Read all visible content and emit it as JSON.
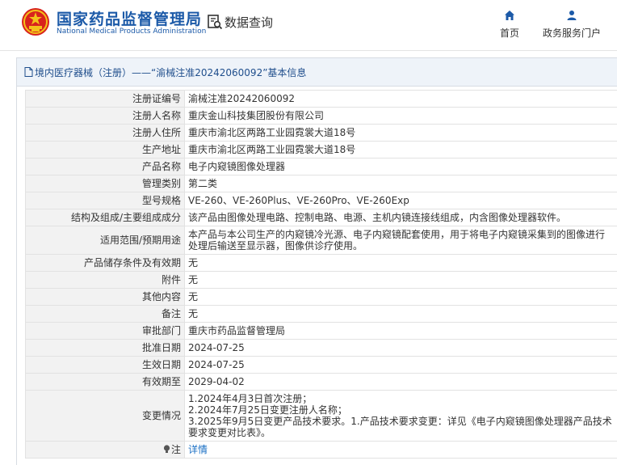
{
  "header": {
    "title_cn": "国家药品监督管理局",
    "title_en": "National Medical Products Administration",
    "query_label": "数据查询",
    "nav": [
      {
        "label": "首页",
        "icon": "home-icon"
      },
      {
        "label": "政务服务门户",
        "icon": "user-icon"
      }
    ]
  },
  "breadcrumb": {
    "text": "境内医疗器械（注册）——“渝械注准20242060092”基本信息"
  },
  "details": {
    "label": "注",
    "link": "详情"
  },
  "rows": [
    {
      "label": "注册证编号",
      "value": "渝械注准20242060092"
    },
    {
      "label": "注册人名称",
      "value": "重庆金山科技集团股份有限公司"
    },
    {
      "label": "注册人住所",
      "value": "重庆市渝北区两路工业园霓裳大道18号"
    },
    {
      "label": "生产地址",
      "value": "重庆市渝北区两路工业园霓裳大道18号"
    },
    {
      "label": "产品名称",
      "value": "电子内窥镜图像处理器"
    },
    {
      "label": "管理类别",
      "value": "第二类"
    },
    {
      "label": "型号规格",
      "value": "VE-260、VE-260Plus、VE-260Pro、VE-260Exp"
    },
    {
      "label": "结构及组成/主要组成成分",
      "value": "该产品由图像处理电路、控制电路、电源、主机内镜连接线组成，内含图像处理器软件。"
    },
    {
      "label": "适用范围/预期用途",
      "value": "本产品与本公司生产的内窥镜冷光源、电子内窥镜配套使用，用于将电子内窥镜采集到的图像进行处理后输送至显示器，图像供诊疗使用。"
    },
    {
      "label": "产品储存条件及有效期",
      "value": "无"
    },
    {
      "label": "附件",
      "value": "无"
    },
    {
      "label": "其他内容",
      "value": "无"
    },
    {
      "label": "备注",
      "value": "无"
    },
    {
      "label": "审批部门",
      "value": "重庆市药品监督管理局"
    },
    {
      "label": "批准日期",
      "value": "2024-07-25"
    },
    {
      "label": "生效日期",
      "value": "2024-07-25"
    },
    {
      "label": "有效期至",
      "value": "2029-04-02"
    }
  ],
  "change_history": {
    "label": "变更情况",
    "lines": [
      "1.2024年4月3日首次注册；",
      "2.2024年7月25日变更注册人名称；",
      "3.2025年9月5日变更产品技术要求。1.产品技术要求变更：详见《电子内窥镜图像处理器产品技术要求变更对比表》。"
    ]
  },
  "colors": {
    "brand_blue": "#1c5aa8",
    "link_blue": "#1a6fc4",
    "label_bg": "#f2f2f2",
    "breadcrumb_bg": "#eef3f9"
  }
}
